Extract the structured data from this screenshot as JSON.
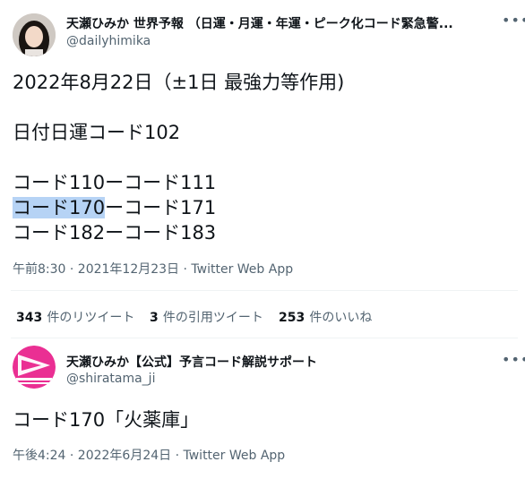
{
  "tweet1": {
    "display_name": "天瀬ひみか 世界予報 （日運・月運・年運・ピーク化コード緊急警...",
    "handle": "@dailyhimika",
    "more_icon": "more-icon",
    "lines": [
      "2022年8月22日（±1日 最強力等作用)",
      "日付日運コード102",
      "コード110ーコード111",
      "コード170",
      "ーコード171",
      "コード182ーコード183"
    ],
    "timestamp": "午前8:30 · 2021年12月23日 · Twitter Web App"
  },
  "stats": [
    {
      "count": "343",
      "label": "件のリツイート"
    },
    {
      "count": "3",
      "label": "件の引用ツイート"
    },
    {
      "count": "253",
      "label": "件のいいね"
    }
  ],
  "tweet2": {
    "display_name": "天瀬ひみか【公式】予言コード解説サポート",
    "handle": "@shiratama_ji",
    "text": "コード170「火薬庫」",
    "timestamp": "午後4:24 · 2022年6月24日 · Twitter Web App"
  },
  "colors": {
    "text": "#0f1419",
    "secondary": "#536471",
    "highlight": "#b6d3f5",
    "avatar2_brand": "#ea2f93"
  }
}
